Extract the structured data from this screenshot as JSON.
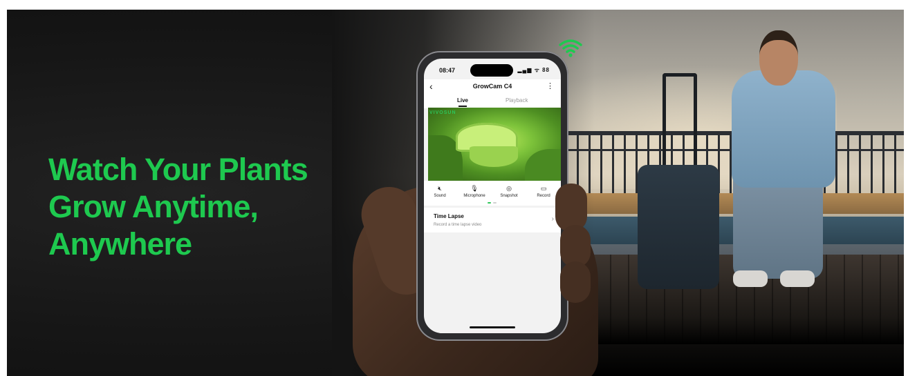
{
  "headline": {
    "line1": "Watch Your Plants",
    "line2": "Grow Anytime,",
    "line3": "Anywhere"
  },
  "colors": {
    "accent_green": "#1ec94f",
    "background_dark": "#141414"
  },
  "phone": {
    "status_time": "08:47",
    "status_icons": "▂▄▆ ᯤ 88",
    "nav": {
      "back_icon": "chevron-left-icon",
      "title": "GrowCam C4",
      "more_icon": "more-vertical-icon"
    },
    "tabs": [
      {
        "label": "Live",
        "selected": true
      },
      {
        "label": "Playback",
        "selected": false
      }
    ],
    "video": {
      "watermark": "VIVOSUN"
    },
    "controls": [
      {
        "label": "Sound",
        "icon": "speaker-mute-icon",
        "glyph": "🔇︎"
      },
      {
        "label": "Microphone",
        "icon": "microphone-off-icon",
        "glyph": "🎙︎"
      },
      {
        "label": "Snapshot",
        "icon": "camera-icon",
        "glyph": "◎"
      },
      {
        "label": "Record",
        "icon": "video-camera-icon",
        "glyph": "▭"
      }
    ],
    "time_lapse": {
      "title": "Time Lapse",
      "subtitle": "Record a time lapse video",
      "chevron": "›"
    }
  }
}
